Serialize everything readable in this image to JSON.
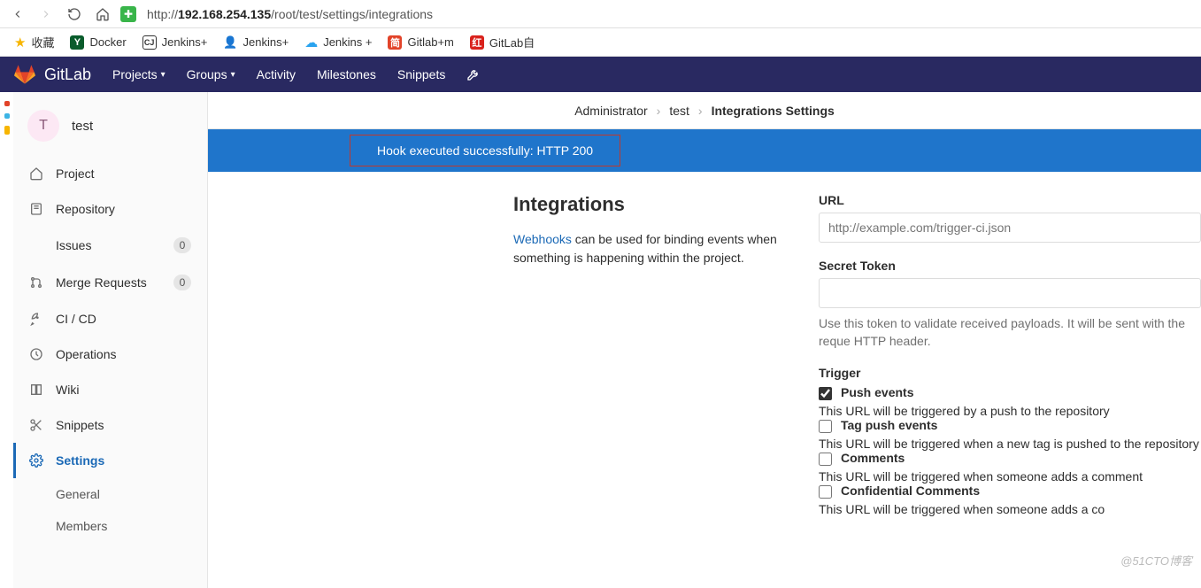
{
  "browser": {
    "url_prefix": "http://",
    "url_host": "192.168.254.135",
    "url_path": "/root/test/settings/integrations"
  },
  "bookmarks": [
    {
      "icon": "star",
      "color": "#f7b500",
      "label": "收藏"
    },
    {
      "icon": "Y",
      "color": "#0a5c2c",
      "label": "Docker"
    },
    {
      "icon": "CJ",
      "color": "#333",
      "label": "Jenkins+"
    },
    {
      "icon": "人",
      "color": "#333",
      "label": "Jenkins+"
    },
    {
      "icon": "∞",
      "color": "#2aa3ef",
      "label": "Jenkins +"
    },
    {
      "icon": "简",
      "color": "#e24329",
      "label": "Gitlab+m"
    },
    {
      "icon": "红",
      "color": "#d9221c",
      "label": "GitLab自"
    }
  ],
  "nav": {
    "brand": "GitLab",
    "items": [
      "Projects",
      "Groups",
      "Activity",
      "Milestones",
      "Snippets"
    ]
  },
  "sidebar": {
    "project_initial": "T",
    "project_name": "test",
    "items": [
      {
        "icon": "home",
        "label": "Project"
      },
      {
        "icon": "repo",
        "label": "Repository"
      },
      {
        "icon": "issues",
        "label": "Issues",
        "badge": "0",
        "indent": true
      },
      {
        "icon": "merge",
        "label": "Merge Requests",
        "badge": "0"
      },
      {
        "icon": "rocket",
        "label": "CI / CD"
      },
      {
        "icon": "ops",
        "label": "Operations"
      },
      {
        "icon": "book",
        "label": "Wiki"
      },
      {
        "icon": "scissors",
        "label": "Snippets"
      },
      {
        "icon": "gear",
        "label": "Settings",
        "active": true
      }
    ],
    "sub": [
      "General",
      "Members"
    ]
  },
  "breadcrumbs": {
    "a": "Administrator",
    "b": "test",
    "c": "Integrations Settings"
  },
  "flash": "Hook executed successfully: HTTP 200",
  "desc": {
    "title": "Integrations",
    "link": "Webhooks",
    "text": " can be used for binding events when something is happening within the project."
  },
  "form": {
    "url_label": "URL",
    "url_placeholder": "http://example.com/trigger-ci.json",
    "token_label": "Secret Token",
    "token_help": "Use this token to validate received payloads. It will be sent with the reque HTTP header.",
    "trigger_label": "Trigger",
    "triggers": [
      {
        "checked": true,
        "label": "Push events",
        "desc": "This URL will be triggered by a push to the repository"
      },
      {
        "checked": false,
        "label": "Tag push events",
        "desc": "This URL will be triggered when a new tag is pushed to the repository"
      },
      {
        "checked": false,
        "label": "Comments",
        "desc": "This URL will be triggered when someone adds a comment"
      },
      {
        "checked": false,
        "label": "Confidential Comments",
        "desc": "This URL will be triggered when someone adds a co"
      }
    ]
  },
  "watermark": "@51CTO博客"
}
